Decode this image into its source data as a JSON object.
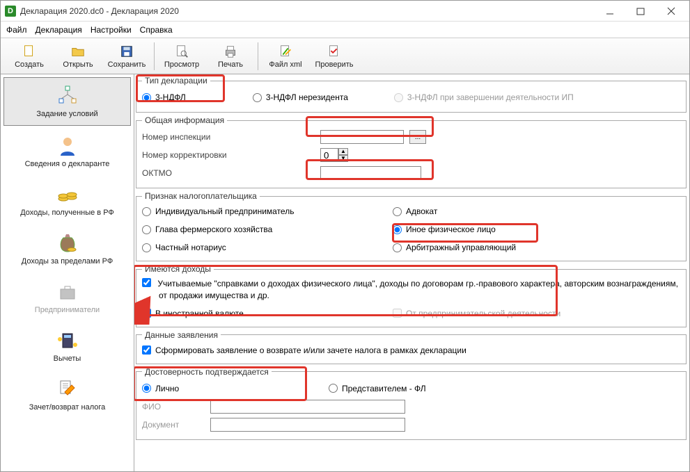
{
  "window": {
    "title": "Декларация 2020.dc0 - Декларация 2020"
  },
  "menu": {
    "file": "Файл",
    "decl": "Декларация",
    "settings": "Настройки",
    "help": "Справка"
  },
  "toolbar": {
    "create": "Создать",
    "open": "Открыть",
    "save": "Сохранить",
    "preview": "Просмотр",
    "print": "Печать",
    "xml": "Файл xml",
    "check": "Проверить"
  },
  "sidebar": {
    "conditions": "Задание условий",
    "declarant": "Сведения о декларанте",
    "income_rf": "Доходы, полученные в РФ",
    "income_abroad": "Доходы за пределами РФ",
    "entrepreneurs": "Предприниматели",
    "deductions": "Вычеты",
    "offset": "Зачет/возврат налога"
  },
  "groups": {
    "decl_type": "Тип декларации",
    "general": "Общая информация",
    "taxpayer": "Признак налогоплательщика",
    "has_income": "Имеются доходы",
    "statement": "Данные заявления",
    "confirm": "Достоверность подтверждается"
  },
  "decl_type": {
    "ndfl3": "3-НДФЛ",
    "nonres": "3-НДФЛ нерезидента",
    "closed_ip": "3-НДФЛ при завершении деятельности ИП"
  },
  "general": {
    "inspection_label": "Номер инспекции",
    "inspection_value": "",
    "correction_label": "Номер корректировки",
    "correction_value": "0",
    "oktmo_label": "ОКТМО",
    "oktmo_value": ""
  },
  "taxpayer": {
    "ip": "Индивидуальный предприниматель",
    "farmer": "Глава фермерского хозяйства",
    "notary": "Частный нотариус",
    "advocate": "Адвокат",
    "other_person": "Иное физическое лицо",
    "arbitr": "Арбитражный управляющий"
  },
  "income": {
    "spravki_line": "Учитываемые \"справками о доходах физического лица\", доходы по договорам гр.-правового характера, авторским вознаграждениям, от продажи имущества и др.",
    "foreign": "В иностранной валюте",
    "business": "От предпринимательской деятельности"
  },
  "statement": {
    "generate": "Сформировать заявление о  возврате и/или зачете налога в рамках декларации"
  },
  "confirm": {
    "self": "Лично",
    "rep_fl": "Представителем - ФЛ",
    "fio_label": "ФИО",
    "doc_label": "Документ"
  }
}
